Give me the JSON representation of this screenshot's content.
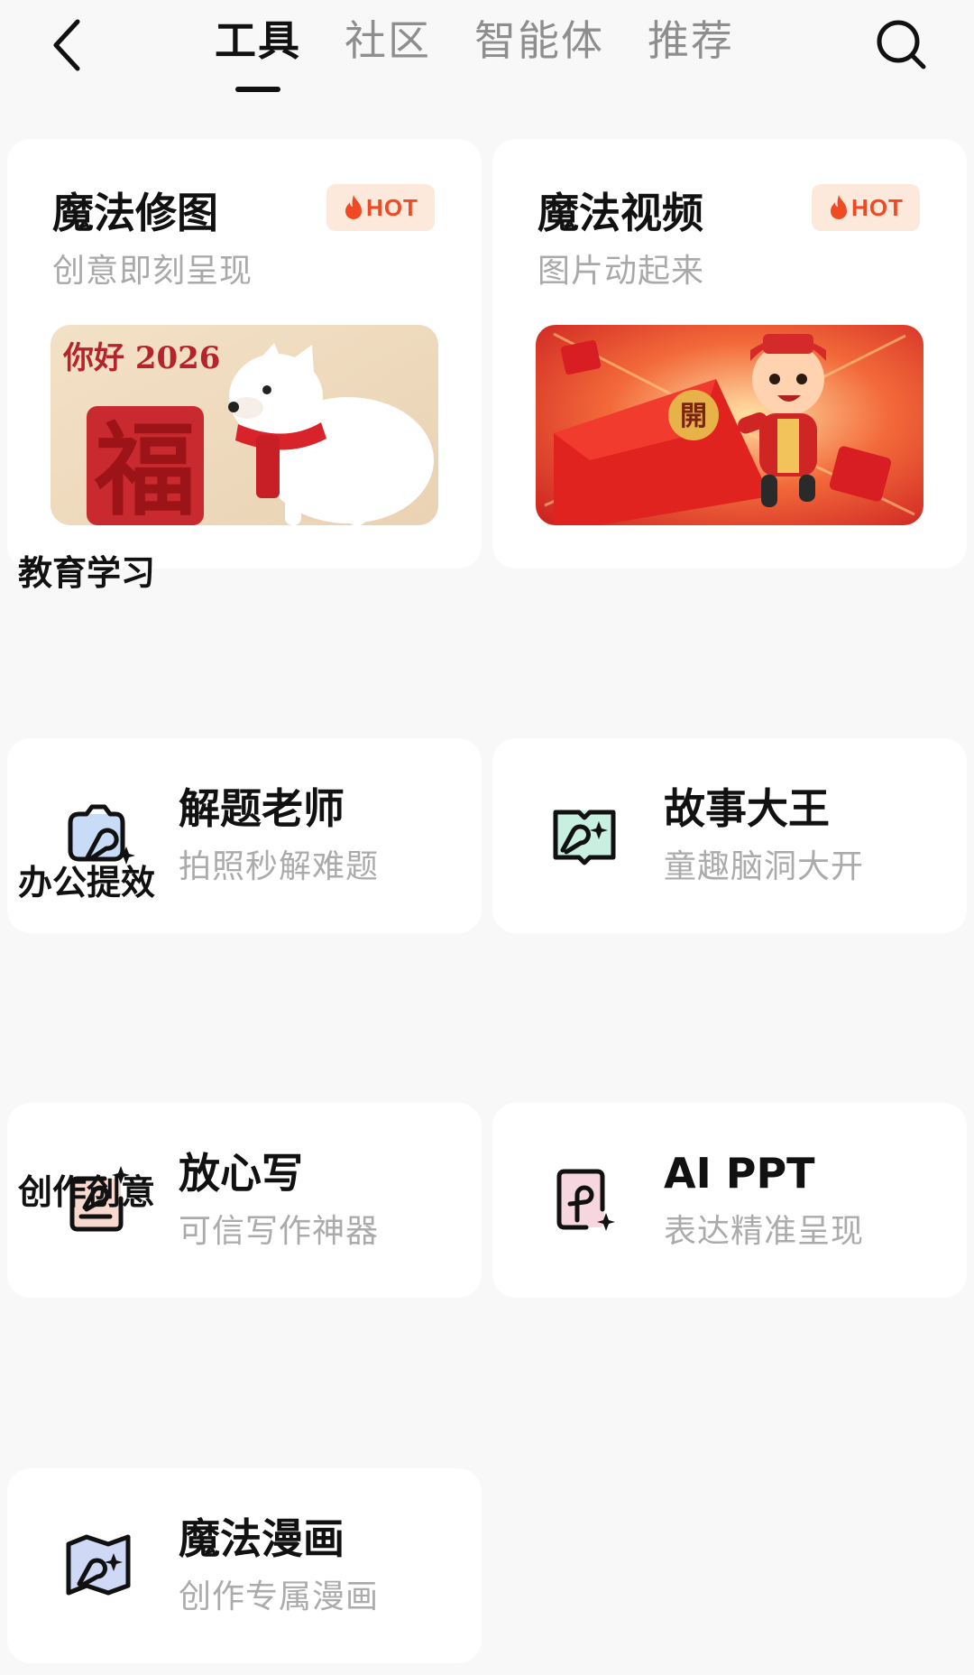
{
  "nav": {
    "tabs": [
      {
        "label": "工具",
        "active": true
      },
      {
        "label": "社区",
        "active": false
      },
      {
        "label": "智能体",
        "active": false
      },
      {
        "label": "推荐",
        "active": false
      }
    ],
    "back_icon": "chevron-left-icon",
    "search_icon": "search-icon"
  },
  "features": [
    {
      "title": "魔法修图",
      "subtitle": "创意即刻呈现",
      "badge": "HOT",
      "image_text": "你好 2026",
      "image_glyph": "福"
    },
    {
      "title": "魔法视频",
      "subtitle": "图片动起来",
      "badge": "HOT",
      "image_glyph": "開"
    }
  ],
  "sections": [
    {
      "title": "教育学习",
      "tools": [
        {
          "name": "解题老师",
          "desc": "拍照秒解难题",
          "icon": "camera-sparkle-icon"
        },
        {
          "name": "故事大王",
          "desc": "童趣脑洞大开",
          "icon": "storybook-icon"
        }
      ]
    },
    {
      "title": "办公提效",
      "tools": [
        {
          "name": "放心写",
          "desc": "可信写作神器",
          "icon": "writing-icon"
        },
        {
          "name": "AI PPT",
          "desc": "表达精准呈现",
          "icon": "slides-icon"
        }
      ]
    },
    {
      "title": "创作创意",
      "tools": [
        {
          "name": "魔法漫画",
          "desc": "创作专属漫画",
          "icon": "comic-map-icon"
        }
      ]
    }
  ],
  "colors": {
    "hot_text": "#f04a24",
    "hot_bg": "#fde9dc",
    "icon_blue": "#c9dcf7",
    "icon_mint": "#c9efe1",
    "icon_peach": "#f8d9cf",
    "icon_pink": "#f6d6df"
  }
}
